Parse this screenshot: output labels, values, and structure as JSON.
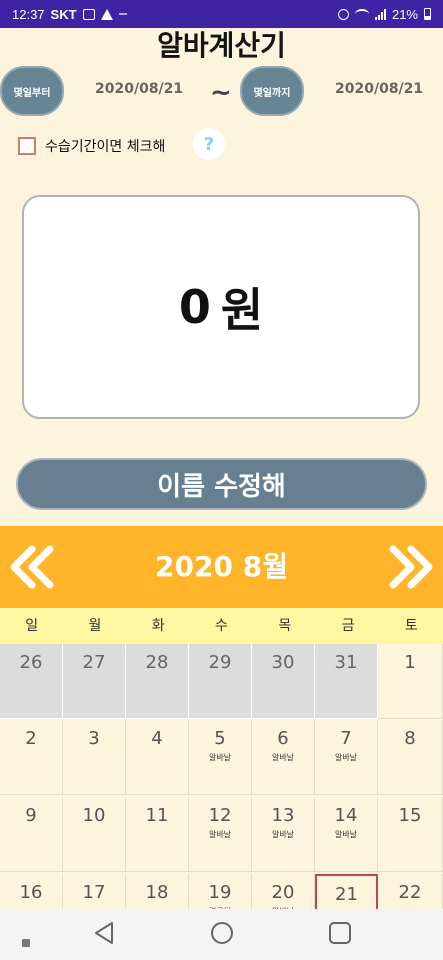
{
  "status_bar": {
    "time": "12:37",
    "carrier": "SKT",
    "battery": "21%"
  },
  "app": {
    "title": "알바계산기"
  },
  "period": {
    "start_button": "몇일부터",
    "start_date": "2020/08/21",
    "separator": "~",
    "end_button": "몇일까지",
    "end_date": "2020/08/21"
  },
  "probation": {
    "label": "수습기간이면 체크해",
    "checked": false,
    "help": "?"
  },
  "result": {
    "amount": "0",
    "unit": "원"
  },
  "rename_button": "이름 수정해",
  "calendar": {
    "title": "2020 8월",
    "weekdays": [
      "일",
      "월",
      "화",
      "수",
      "목",
      "금",
      "토"
    ],
    "weeks": [
      [
        {
          "day": "26",
          "other": true
        },
        {
          "day": "27",
          "other": true
        },
        {
          "day": "28",
          "other": true
        },
        {
          "day": "29",
          "other": true
        },
        {
          "day": "30",
          "other": true
        },
        {
          "day": "31",
          "other": true
        },
        {
          "day": "1"
        }
      ],
      [
        {
          "day": "2"
        },
        {
          "day": "3"
        },
        {
          "day": "4"
        },
        {
          "day": "5",
          "shift": "알바날"
        },
        {
          "day": "6",
          "shift": "알바날"
        },
        {
          "day": "7",
          "shift": "알바날"
        },
        {
          "day": "8"
        }
      ],
      [
        {
          "day": "9"
        },
        {
          "day": "10"
        },
        {
          "day": "11"
        },
        {
          "day": "12",
          "shift": "알바날"
        },
        {
          "day": "13",
          "shift": "알바날"
        },
        {
          "day": "14",
          "shift": "알바날"
        },
        {
          "day": "15"
        }
      ],
      [
        {
          "day": "16"
        },
        {
          "day": "17"
        },
        {
          "day": "18"
        },
        {
          "day": "19",
          "shift": "결근됨",
          "shift_red": true
        },
        {
          "day": "20",
          "shift": "알바날"
        },
        {
          "day": "21",
          "shift": "알바날",
          "today": true
        },
        {
          "day": "22"
        }
      ]
    ]
  },
  "colors": {
    "status_bar": "#3f23a5",
    "background": "#fdf4de",
    "pill_button": "#668594",
    "calendar_header": "#ffb42a",
    "weekday_row": "#fdf7a2",
    "today_border": "#b74a4a"
  }
}
